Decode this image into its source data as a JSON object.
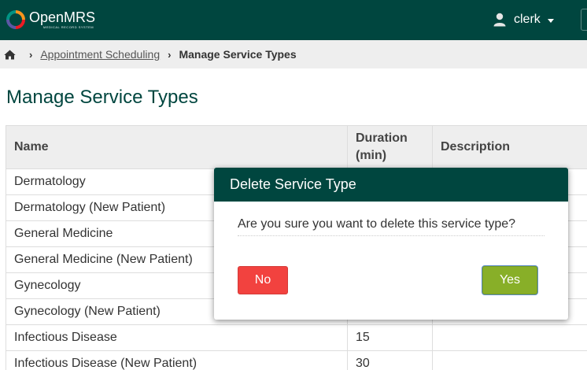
{
  "header": {
    "app_name": "OpenMRS",
    "tagline": "MEDICAL RECORD SYSTEM",
    "user_name": "clerk"
  },
  "breadcrumb": {
    "home_icon": "home-icon",
    "link_label": "Appointment Scheduling",
    "current_label": "Manage Service Types"
  },
  "page": {
    "title": "Manage Service Types"
  },
  "table": {
    "headers": {
      "name": "Name",
      "duration": "Duration (min)",
      "description": "Description"
    },
    "rows": [
      {
        "name": "Dermatology",
        "duration": "",
        "description": ""
      },
      {
        "name": "Dermatology (New Patient)",
        "duration": "",
        "description": ""
      },
      {
        "name": "General Medicine",
        "duration": "",
        "description": ""
      },
      {
        "name": "General Medicine (New Patient)",
        "duration": "",
        "description": ""
      },
      {
        "name": "Gynecology",
        "duration": "",
        "description": ""
      },
      {
        "name": "Gynecology (New Patient)",
        "duration": "",
        "description": ""
      },
      {
        "name": "Infectious Disease",
        "duration": "15",
        "description": ""
      },
      {
        "name": "Infectious Disease (New Patient)",
        "duration": "30",
        "description": ""
      }
    ]
  },
  "dialog": {
    "title": "Delete Service Type",
    "message": "Are you sure you want to delete this service type?",
    "no_label": "No",
    "yes_label": "Yes"
  },
  "colors": {
    "brand": "#00463f",
    "danger": "#f2423f",
    "confirm": "#88af28"
  }
}
